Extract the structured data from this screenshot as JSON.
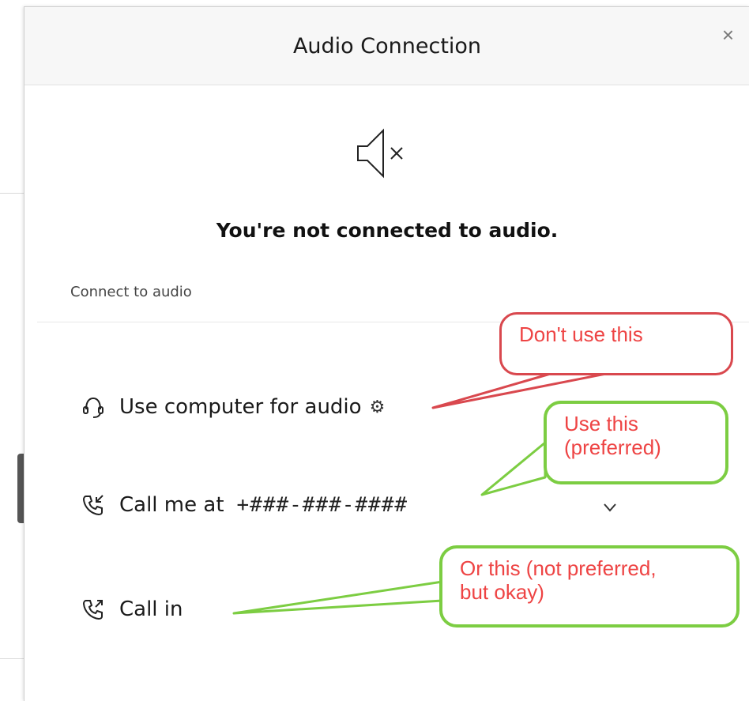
{
  "dialog": {
    "title": "Audio Connection",
    "close_symbol": "×",
    "status_icon": "speaker-muted-icon",
    "headline": "You're not connected to audio.",
    "section_label": "Connect to audio"
  },
  "options": [
    {
      "label": "Use computer for audio",
      "icon": "headset-icon",
      "extra_icon": "gear-icon",
      "extra_symbol": "⚙"
    },
    {
      "label": "Call me at",
      "icon": "phone-incoming-icon",
      "phone": "+###-###-####",
      "dropdown_icon": "chevron-down-icon"
    },
    {
      "label": "Call in",
      "icon": "phone-outgoing-icon"
    }
  ],
  "annotations": [
    {
      "text": "Don't use this",
      "color": "#d9484e"
    },
    {
      "text": "Use this (preferred)",
      "line1": "Use this",
      "line2": "(preferred)",
      "color": "#7ccd42"
    },
    {
      "text": "Or this (not preferred, but okay)",
      "line1": "Or this (not preferred,",
      "line2": "but okay)",
      "color": "#7ccd42"
    }
  ],
  "colors": {
    "annotation_text": "#ee4444",
    "title_bar": "#f7f7f7"
  }
}
